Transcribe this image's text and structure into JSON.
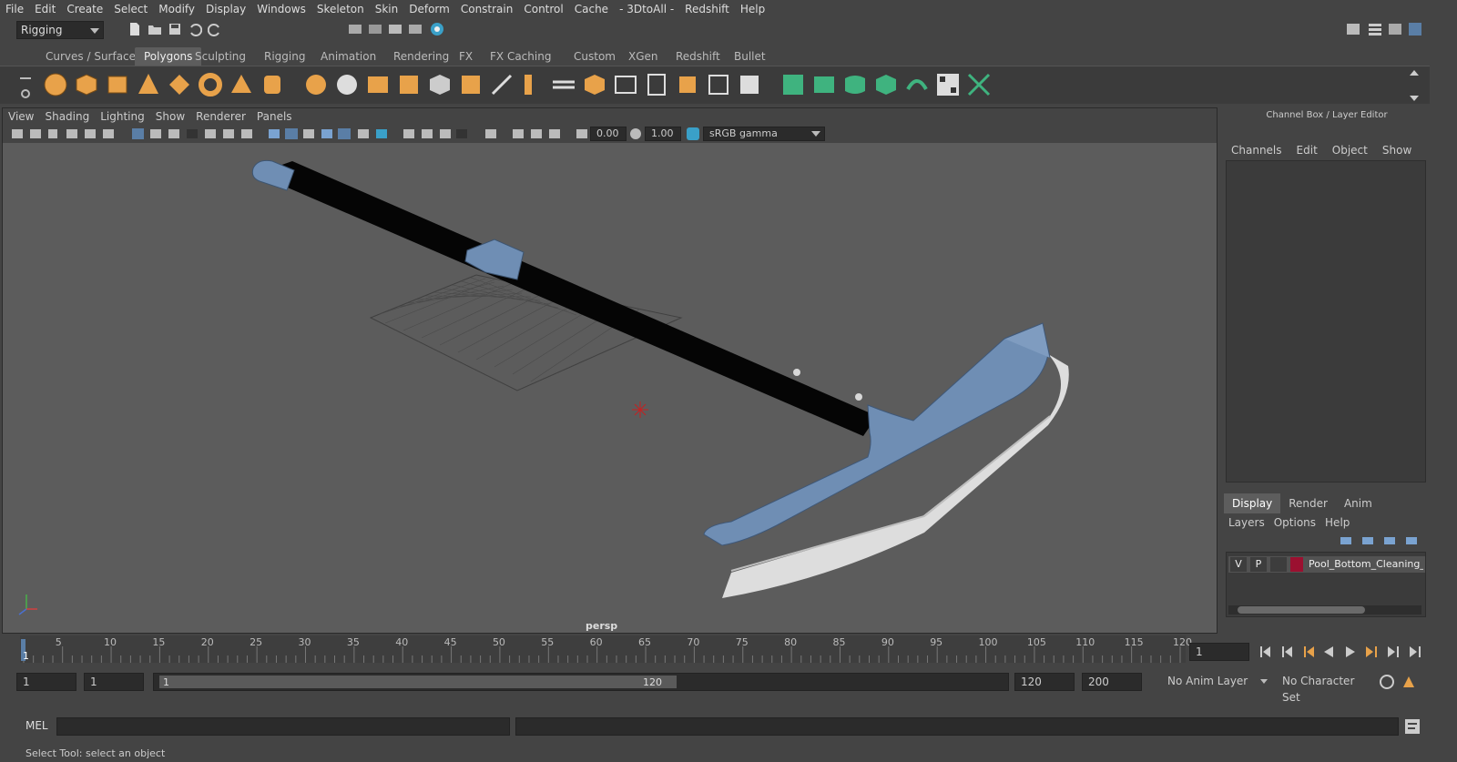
{
  "menubar": {
    "items": [
      "File",
      "Edit",
      "Create",
      "Select",
      "Modify",
      "Display",
      "Windows",
      "Skeleton",
      "Skin",
      "Deform",
      "Constrain",
      "Control",
      "Cache",
      "- 3DtoAll -",
      "Redshift",
      "Help"
    ]
  },
  "mode_selector": {
    "value": "Rigging"
  },
  "shelf_tabs": [
    "Curves / Surfaces",
    "Polygons",
    "Sculpting",
    "Rigging",
    "Animation",
    "Rendering",
    "FX",
    "FX Caching",
    "Custom",
    "XGen",
    "Redshift",
    "Bullet"
  ],
  "shelf_active": "Polygons",
  "viewport": {
    "menu": [
      "View",
      "Shading",
      "Lighting",
      "Show",
      "Renderer",
      "Panels"
    ],
    "exposure": "0.00",
    "gamma": "1.00",
    "color_space": "sRGB gamma",
    "camera_label": "persp"
  },
  "channel_box": {
    "title": "Channel Box / Layer Editor",
    "menu": [
      "Channels",
      "Edit",
      "Object",
      "Show"
    ]
  },
  "layer_editor": {
    "tabs": [
      "Display",
      "Render",
      "Anim"
    ],
    "active_tab": "Display",
    "menu": [
      "Layers",
      "Options",
      "Help"
    ],
    "layer": {
      "v": "V",
      "p": "P",
      "name": "Pool_Bottom_Cleaning_B",
      "color": "#9b1030"
    }
  },
  "timeline": {
    "ticks": [
      "5",
      "10",
      "15",
      "20",
      "25",
      "30",
      "35",
      "40",
      "45",
      "50",
      "55",
      "60",
      "65",
      "70",
      "75",
      "80",
      "85",
      "90",
      "95",
      "100",
      "105",
      "110",
      "115",
      "120"
    ],
    "current_frame_marker": "1",
    "current_frame": "1"
  },
  "range": {
    "start": "1",
    "playback_start": "1",
    "slider_start": "1",
    "slider_end": "120",
    "playback_end": "120",
    "end": "200",
    "anim_layer": "No Anim Layer",
    "character_set": "No Character Set"
  },
  "mel": {
    "label": "MEL"
  },
  "status": {
    "text": "Select Tool: select an object"
  },
  "colors": {
    "accent_blue": "#5a7ea6",
    "shelf_orange": "#e8a24a",
    "shelf_green": "#3fb37f"
  }
}
